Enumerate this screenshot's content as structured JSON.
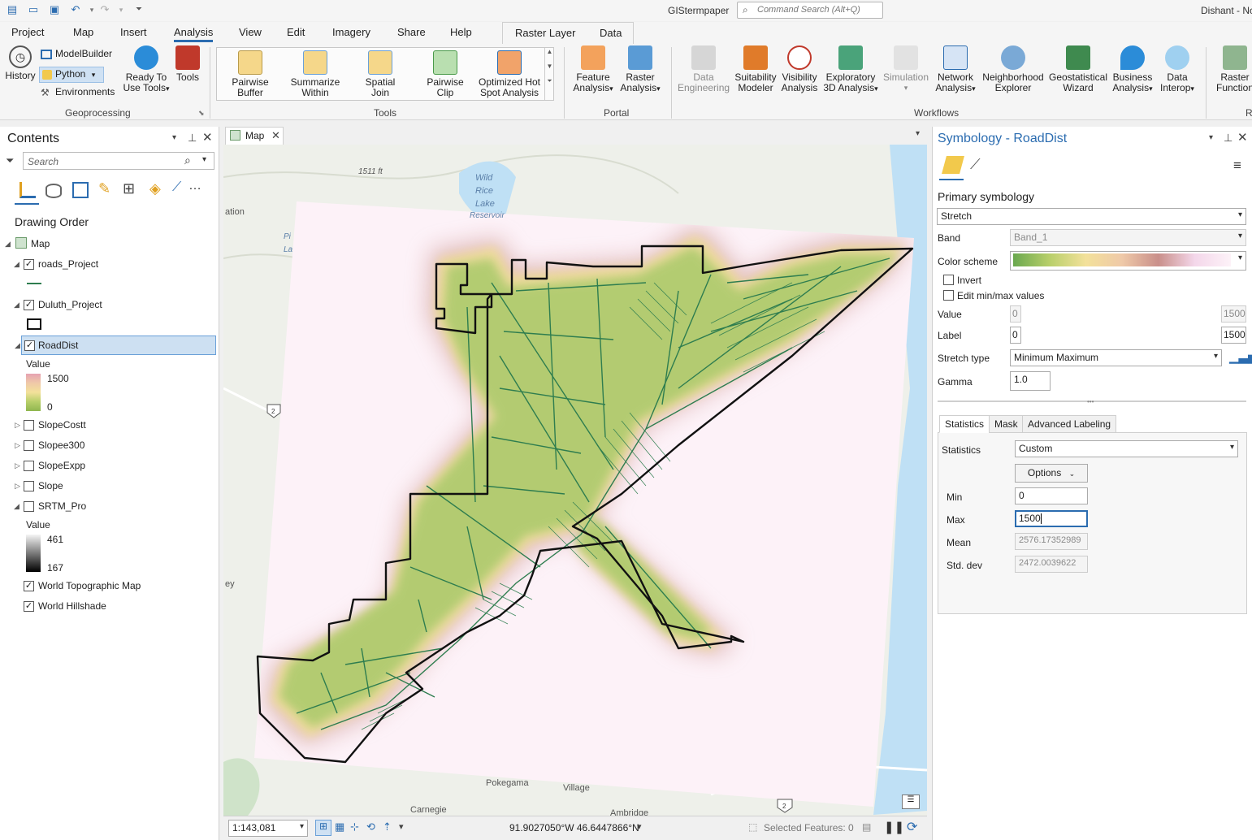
{
  "app": {
    "title": "GIStermpaper",
    "search_placeholder": "Command Search (Alt+Q)",
    "user": "Dishant - Nc"
  },
  "tabs": [
    "Project",
    "Map",
    "Insert",
    "Analysis",
    "View",
    "Edit",
    "Imagery",
    "Share",
    "Help",
    "Raster Layer",
    "Data"
  ],
  "active_tab": "Analysis",
  "ribbon": {
    "geoprocessing": {
      "history": "History",
      "modelbuilder": "ModelBuilder",
      "python": "Python",
      "environments": "Environments",
      "ready_to_use_1": "Ready To",
      "ready_to_use_2": "Use Tools",
      "tools": "Tools",
      "group": "Geoprocessing"
    },
    "tools": {
      "items": [
        [
          "Pairwise",
          "Buffer"
        ],
        [
          "Summarize",
          "Within"
        ],
        [
          "Spatial",
          "Join"
        ],
        [
          "Pairwise",
          "Clip"
        ],
        [
          "Optimized Hot",
          "Spot Analysis"
        ]
      ],
      "group": "Tools"
    },
    "portal": {
      "items": [
        [
          "Feature",
          "Analysis"
        ],
        [
          "Raster",
          "Analysis"
        ]
      ],
      "group": "Portal"
    },
    "workflows": {
      "items": [
        [
          "Data",
          "Engineering"
        ],
        [
          "Suitability",
          "Modeler"
        ],
        [
          "Visibility",
          "Analysis"
        ],
        [
          "Exploratory",
          "3D Analysis"
        ],
        [
          "Simulation",
          ""
        ],
        [
          "Network",
          "Analysis"
        ],
        [
          "Neighborhood",
          "Explorer"
        ],
        [
          "Geostatistical",
          "Wizard"
        ],
        [
          "Business",
          "Analysis"
        ],
        [
          "Data",
          "Interop"
        ],
        [
          "Raster",
          "Function"
        ]
      ],
      "group": "Workflows",
      "group_r": "R"
    }
  },
  "contents": {
    "title": "Contents",
    "search_placeholder": "Search",
    "drawing_order": "Drawing Order",
    "map": "Map",
    "layers": {
      "roads": "roads_Project",
      "duluth": "Duluth_Project",
      "roaddist": "RoadDist",
      "value_label": "Value",
      "roaddist_max": "1500",
      "roaddist_min": "0",
      "slopecostt": "SlopeCostt",
      "slopee300": "Slopee300",
      "slopeexpp": "SlopeExpp",
      "slope": "Slope",
      "srtm": "SRTM_Pro",
      "srtm_max": "461",
      "srtm_min": "167",
      "topo": "World Topographic Map",
      "hillshade": "World Hillshade"
    }
  },
  "map": {
    "tab": "Map",
    "labels": {
      "elev": "1511 ft",
      "wild1": "Wild",
      "wild2": "Rice",
      "wild3": "Lake",
      "wild4": "Reservoir",
      "ation": "ation",
      "pi": "Pi",
      "la": "La",
      "ey": "ey",
      "pokegama": "Pokegama",
      "village": "Village",
      "carnegie": "Carnegie",
      "ambridge": "Ambridge",
      "hwy2": "2",
      "hwy2b": "2"
    }
  },
  "status": {
    "scale": "1:143,081",
    "coords": "91.9027050°W 46.6447866°N",
    "selected": "Selected Features: 0"
  },
  "symbology": {
    "title": "Symbology - RoadDist",
    "primary": "Primary symbology",
    "method": "Stretch",
    "band_label": "Band",
    "band": "Band_1",
    "scheme_label": "Color scheme",
    "invert": "Invert",
    "edit_minmax": "Edit min/max values",
    "value_label": "Value",
    "value_min": "0",
    "value_max": "1500",
    "label_label": "Label",
    "label_min": "0",
    "label_max": "1500",
    "stretch_label": "Stretch type",
    "stretch": "Minimum Maximum",
    "gamma_label": "Gamma",
    "gamma": "1.0",
    "subtabs": [
      "Statistics",
      "Mask",
      "Advanced Labeling"
    ],
    "stats_label": "Statistics",
    "stats": "Custom",
    "options": "Options",
    "min_label": "Min",
    "min": "0",
    "max_label": "Max",
    "max": "1500",
    "mean_label": "Mean",
    "mean": "2576.17352989",
    "std_label": "Std. dev",
    "std": "2472.0039622"
  },
  "colors": {
    "accent": "#2b6cb0",
    "road_green": "#2e7d4f",
    "near": "#8fbf5a",
    "mid": "#f1df9a",
    "far": "#c98f8a",
    "background": "#fdf2f8"
  }
}
